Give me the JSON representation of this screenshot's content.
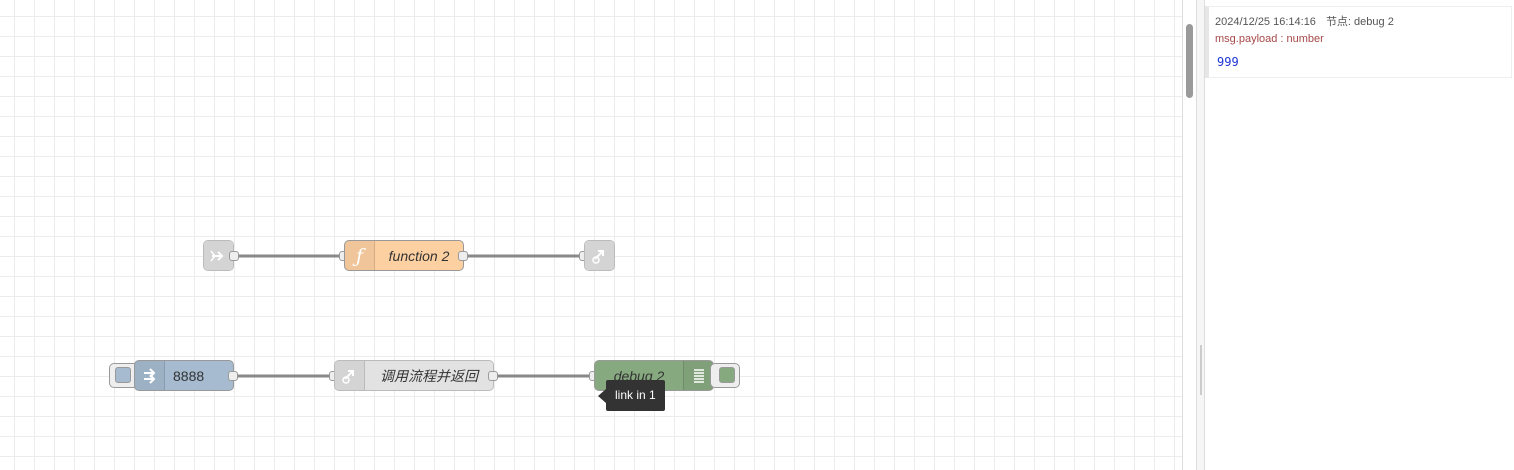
{
  "canvas": {
    "nodes": {
      "link_in": {
        "label": "",
        "icon": "link-in-icon"
      },
      "function": {
        "label": "function 2",
        "icon": "function-icon",
        "color": "#fdd0a2"
      },
      "link_out": {
        "label": "",
        "icon": "link-out-icon"
      },
      "http_in": {
        "label": "8888",
        "icon": "arrow-in-icon",
        "color": "#a6bbcf"
      },
      "link_call": {
        "label": "调用流程并返回",
        "icon": "link-call-icon"
      },
      "debug": {
        "label": "debug 2",
        "icon": "list-icon",
        "color": "#87a980"
      }
    },
    "tooltip": "link in 1"
  },
  "debug_panel": {
    "messages": [
      {
        "timestamp": "2024/12/25 16:14:16",
        "node_label": "节点: debug 2",
        "path": "msg.payload : number",
        "value": "999"
      }
    ]
  }
}
